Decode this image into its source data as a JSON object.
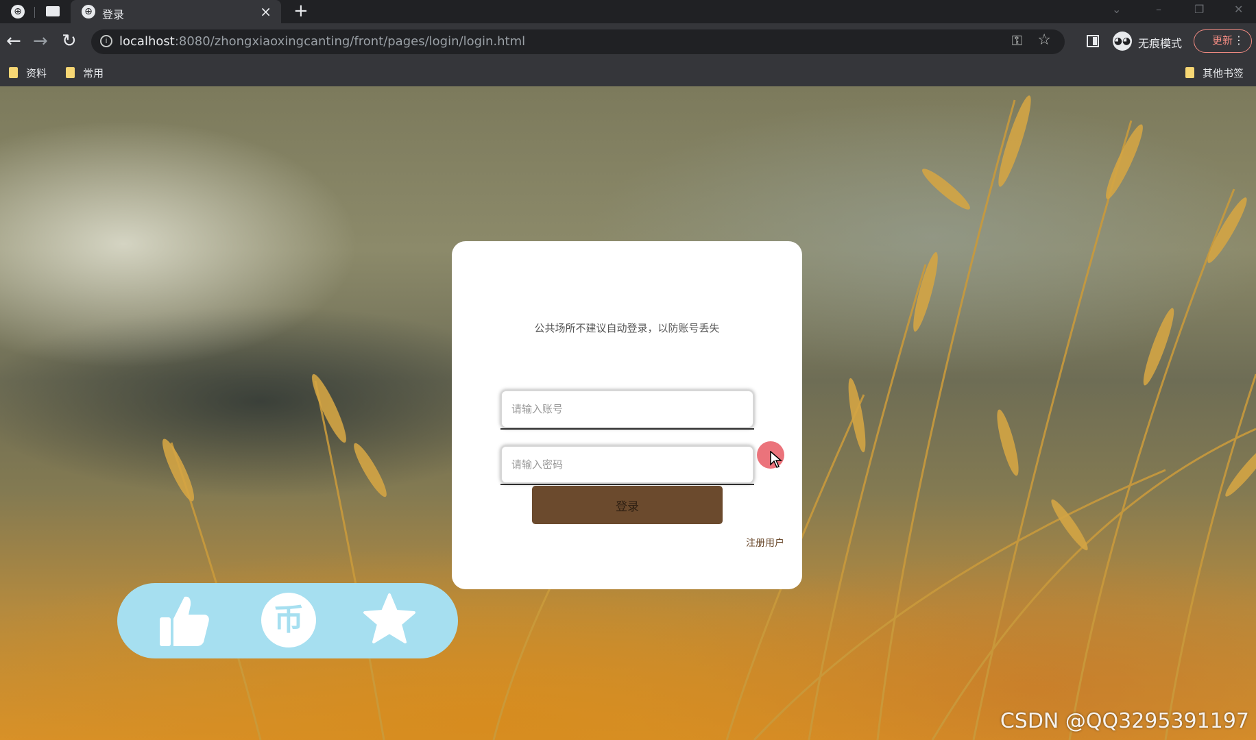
{
  "browser": {
    "tab_title": "登录",
    "tab_close": "×",
    "new_tab": "+",
    "url_host": "localhost",
    "url_rest": ":8080/zhongxiaoxingcanting/front/pages/login/login.html",
    "incognito_label": "无痕模式",
    "update_label": "更新",
    "bookmarks": [
      "资料",
      "常用"
    ],
    "other_bookmarks": "其他书签",
    "icons": {
      "back": "back-arrow-icon",
      "forward": "forward-arrow-icon",
      "reload": "reload-icon",
      "key": "key-icon",
      "star": "star-icon",
      "side_panel": "side-panel-icon",
      "incognito": "incognito-icon",
      "menu": "kebab-menu-icon"
    }
  },
  "login": {
    "notice": "公共场所不建议自动登录，以防账号丢失",
    "account_placeholder": "请输入账号",
    "password_placeholder": "请输入密码",
    "login_label": "登录",
    "register_label": "注册用户"
  },
  "actions": {
    "like": "thumbs-up-icon",
    "coin": "coin-icon",
    "coin_glyph": "币",
    "favorite": "star-icon"
  },
  "watermark": "CSDN @QQ3295391197",
  "colors": {
    "login_button": "#6b4a2d",
    "action_pill": "#a6dff0",
    "update_accent": "#f28b82"
  }
}
